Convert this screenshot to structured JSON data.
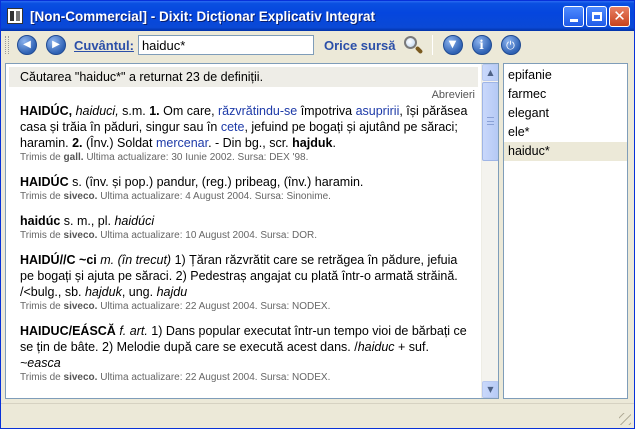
{
  "window": {
    "title": "[Non-Commercial] - Dixit: Dicționar Explicativ Integrat"
  },
  "toolbar": {
    "word_label": "Cuvântul:",
    "search_value": "haiduc*",
    "source_label": "Orice sursă"
  },
  "results": {
    "summary": "Căutarea \"haiduc*\" a returnat 23 de definiții.",
    "abrevieri": "Abrevieri",
    "definitions": [
      {
        "p0_head": "HAIDÚC,",
        "p1": " ",
        "p2_it": "haiduci,",
        "p3": " s.m. ",
        "p4_bd": "1.",
        "p5": " Om care, ",
        "p6_lnk": "răzvrătindu-se",
        "p7": " împotriva ",
        "p8_lnk": "asupririi",
        "p9": ", își părăsea casa și trăia în păduri, singur sau în ",
        "p10_lnk": "cete",
        "p11": ", jefuind pe bogați și ajutând pe săraci; haramin. ",
        "p12_bd": "2.",
        "p13": " (Înv.) Soldat ",
        "p14_lnk": "mercenar",
        "p15": ". - Din bg., scr. ",
        "p16_bd": "hajduk",
        "p17": ".",
        "meta_prefix": "Trimis de ",
        "meta_who": "gall.",
        "meta_rest": " Ultima actualizare: 30 Iunie 2002. Sursa: DEX '98."
      },
      {
        "p0_head": "HAIDÚC",
        "p1": " s. (înv. și pop.) pandur, (reg.) pribeag, (înv.) haramin.",
        "meta_prefix": "Trimis de ",
        "meta_who": "siveco.",
        "meta_rest": " Ultima actualizare: 4 August 2004. Sursa: Sinonime."
      },
      {
        "p0_head": "haidúc",
        "p1": " s. m., pl. ",
        "p2_it": "haidúci",
        "meta_prefix": "Trimis de ",
        "meta_who": "siveco.",
        "meta_rest": " Ultima actualizare: 10 August 2004. Sursa: DOR."
      },
      {
        "p0_head": "HAIDÚ//C ~ci",
        "p1": " ",
        "p2_it": "m. (în trecut)",
        "p3": " 1) Țăran răzvrătit care se retrăgea în pădure, jefuia pe bogați și ajuta pe săraci. 2) Pedestraș angajat cu plată într-o armată străină. /<bulg., sb. ",
        "p4_it": "hajduk",
        "p5": ", ung. ",
        "p6_it": "hajdu",
        "meta_prefix": "Trimis de ",
        "meta_who": "siveco.",
        "meta_rest": " Ultima actualizare: 22 August 2004. Sursa: NODEX."
      },
      {
        "p0_head": "HAIDUC/EÁSCĂ",
        "p1": " ",
        "p2_it": "f. art.",
        "p3": " 1) Dans popular executat într-un tempo vioi de bărbați ce se țin de bâte. 2) Melodie după care se execută acest dans. /",
        "p4_it": "haiduc",
        "p5": " + suf. ",
        "p6_it": "~easca",
        "meta_prefix": "Trimis de ",
        "meta_who": "siveco.",
        "meta_rest": " Ultima actualizare: 22 August 2004. Sursa: NODEX."
      }
    ]
  },
  "history": {
    "items": [
      "epifanie",
      "farmec",
      "elegant",
      "ele*",
      "haiduc*"
    ],
    "selected_index": 4
  },
  "icons": {
    "back": "arrow-left-icon",
    "forward": "arrow-right-icon",
    "search": "magnifier-icon",
    "filter": "funnel-icon",
    "info": "info-icon",
    "exit": "power-icon"
  },
  "colors": {
    "titlebar": "#0546de",
    "link": "#1d3aa8",
    "label": "#2b4fa8"
  }
}
